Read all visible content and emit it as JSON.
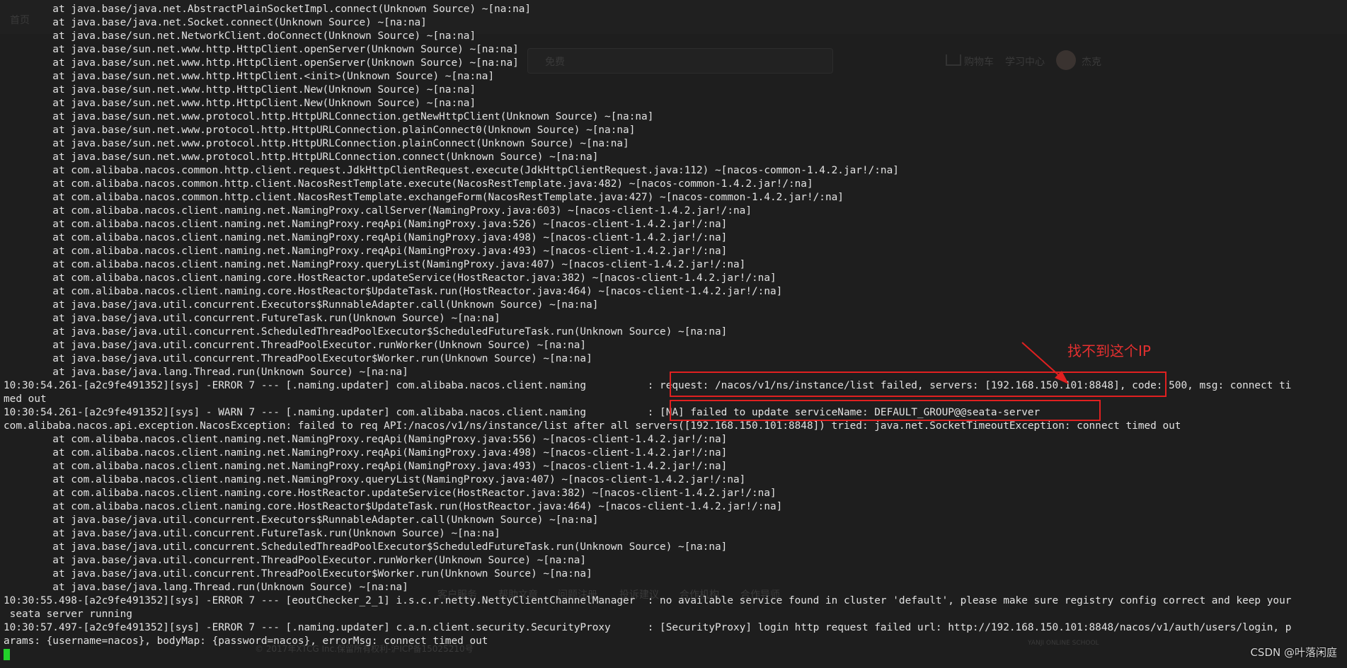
{
  "background_page": {
    "nav_items": [
      "首页",
      "免费",
      "购物车",
      "学习中心",
      "杰克"
    ],
    "footer_items": [
      "客户服务",
      "帮助文章",
      "问题注册",
      "投诉建议",
      "合作机构",
      "合作导师"
    ],
    "copyright": "© 2017年XTCG Inc.保留所有权利-沪ICP备15025210号",
    "logo_text": "YANJI ONLINE SCHOOL"
  },
  "log_lines": [
    "        at java.base/java.net.AbstractPlainSocketImpl.connect(Unknown Source) ~[na:na]",
    "        at java.base/java.net.Socket.connect(Unknown Source) ~[na:na]",
    "        at java.base/sun.net.NetworkClient.doConnect(Unknown Source) ~[na:na]",
    "        at java.base/sun.net.www.http.HttpClient.openServer(Unknown Source) ~[na:na]",
    "        at java.base/sun.net.www.http.HttpClient.openServer(Unknown Source) ~[na:na]",
    "        at java.base/sun.net.www.http.HttpClient.<init>(Unknown Source) ~[na:na]",
    "        at java.base/sun.net.www.http.HttpClient.New(Unknown Source) ~[na:na]",
    "        at java.base/sun.net.www.http.HttpClient.New(Unknown Source) ~[na:na]",
    "        at java.base/sun.net.www.protocol.http.HttpURLConnection.getNewHttpClient(Unknown Source) ~[na:na]",
    "        at java.base/sun.net.www.protocol.http.HttpURLConnection.plainConnect0(Unknown Source) ~[na:na]",
    "        at java.base/sun.net.www.protocol.http.HttpURLConnection.plainConnect(Unknown Source) ~[na:na]",
    "        at java.base/sun.net.www.protocol.http.HttpURLConnection.connect(Unknown Source) ~[na:na]",
    "        at com.alibaba.nacos.common.http.client.request.JdkHttpClientRequest.execute(JdkHttpClientRequest.java:112) ~[nacos-common-1.4.2.jar!/:na]",
    "        at com.alibaba.nacos.common.http.client.NacosRestTemplate.execute(NacosRestTemplate.java:482) ~[nacos-common-1.4.2.jar!/:na]",
    "        at com.alibaba.nacos.common.http.client.NacosRestTemplate.exchangeForm(NacosRestTemplate.java:427) ~[nacos-common-1.4.2.jar!/:na]",
    "        at com.alibaba.nacos.client.naming.net.NamingProxy.callServer(NamingProxy.java:603) ~[nacos-client-1.4.2.jar!/:na]",
    "        at com.alibaba.nacos.client.naming.net.NamingProxy.reqApi(NamingProxy.java:526) ~[nacos-client-1.4.2.jar!/:na]",
    "        at com.alibaba.nacos.client.naming.net.NamingProxy.reqApi(NamingProxy.java:498) ~[nacos-client-1.4.2.jar!/:na]",
    "        at com.alibaba.nacos.client.naming.net.NamingProxy.reqApi(NamingProxy.java:493) ~[nacos-client-1.4.2.jar!/:na]",
    "        at com.alibaba.nacos.client.naming.net.NamingProxy.queryList(NamingProxy.java:407) ~[nacos-client-1.4.2.jar!/:na]",
    "        at com.alibaba.nacos.client.naming.core.HostReactor.updateService(HostReactor.java:382) ~[nacos-client-1.4.2.jar!/:na]",
    "        at com.alibaba.nacos.client.naming.core.HostReactor$UpdateTask.run(HostReactor.java:464) ~[nacos-client-1.4.2.jar!/:na]",
    "        at java.base/java.util.concurrent.Executors$RunnableAdapter.call(Unknown Source) ~[na:na]",
    "        at java.base/java.util.concurrent.FutureTask.run(Unknown Source) ~[na:na]",
    "        at java.base/java.util.concurrent.ScheduledThreadPoolExecutor$ScheduledFutureTask.run(Unknown Source) ~[na:na]",
    "        at java.base/java.util.concurrent.ThreadPoolExecutor.runWorker(Unknown Source) ~[na:na]",
    "        at java.base/java.util.concurrent.ThreadPoolExecutor$Worker.run(Unknown Source) ~[na:na]",
    "        at java.base/java.lang.Thread.run(Unknown Source) ~[na:na]",
    "10:30:54.261-[a2c9fe491352][sys] -ERROR 7 --- [.naming.updater] com.alibaba.nacos.client.naming          : request: /nacos/v1/ns/instance/list failed, servers: [192.168.150.101:8848], code: 500, msg: connect ti",
    "med out",
    "10:30:54.261-[a2c9fe491352][sys] - WARN 7 --- [.naming.updater] com.alibaba.nacos.client.naming          : [NA] failed to update serviceName: DEFAULT_GROUP@@seata-server",
    "com.alibaba.nacos.api.exception.NacosException: failed to req API:/nacos/v1/ns/instance/list after all servers([192.168.150.101:8848]) tried: java.net.SocketTimeoutException: connect timed out",
    "        at com.alibaba.nacos.client.naming.net.NamingProxy.reqApi(NamingProxy.java:556) ~[nacos-client-1.4.2.jar!/:na]",
    "        at com.alibaba.nacos.client.naming.net.NamingProxy.reqApi(NamingProxy.java:498) ~[nacos-client-1.4.2.jar!/:na]",
    "        at com.alibaba.nacos.client.naming.net.NamingProxy.reqApi(NamingProxy.java:493) ~[nacos-client-1.4.2.jar!/:na]",
    "        at com.alibaba.nacos.client.naming.net.NamingProxy.queryList(NamingProxy.java:407) ~[nacos-client-1.4.2.jar!/:na]",
    "        at com.alibaba.nacos.client.naming.core.HostReactor.updateService(HostReactor.java:382) ~[nacos-client-1.4.2.jar!/:na]",
    "        at com.alibaba.nacos.client.naming.core.HostReactor$UpdateTask.run(HostReactor.java:464) ~[nacos-client-1.4.2.jar!/:na]",
    "        at java.base/java.util.concurrent.Executors$RunnableAdapter.call(Unknown Source) ~[na:na]",
    "        at java.base/java.util.concurrent.FutureTask.run(Unknown Source) ~[na:na]",
    "        at java.base/java.util.concurrent.ScheduledThreadPoolExecutor$ScheduledFutureTask.run(Unknown Source) ~[na:na]",
    "        at java.base/java.util.concurrent.ThreadPoolExecutor.runWorker(Unknown Source) ~[na:na]",
    "        at java.base/java.util.concurrent.ThreadPoolExecutor$Worker.run(Unknown Source) ~[na:na]",
    "        at java.base/java.lang.Thread.run(Unknown Source) ~[na:na]",
    "10:30:55.498-[a2c9fe491352][sys] -ERROR 7 --- [eoutChecker_2_1] i.s.c.r.netty.NettyClientChannelManager  : no available service found in cluster 'default', please make sure registry config correct and keep your",
    " seata server running",
    "10:30:57.497-[a2c9fe491352][sys] -ERROR 7 --- [.naming.updater] c.a.n.client.security.SecurityProxy      : [SecurityProxy] login http request failed url: http://192.168.150.101:8848/nacos/v1/auth/users/login, p",
    "arams: {username=nacos}, bodyMap: {password=nacos}, errorMsg: connect timed out"
  ],
  "annotation": {
    "text": "找不到这个IP",
    "color": "#e53030"
  },
  "watermark": "CSDN @叶落闲庭",
  "colors": {
    "terminal_bg": "#1e1e1e",
    "text": "#e2e2e2",
    "highlight": "#e02020",
    "cursor": "#22d12a"
  }
}
